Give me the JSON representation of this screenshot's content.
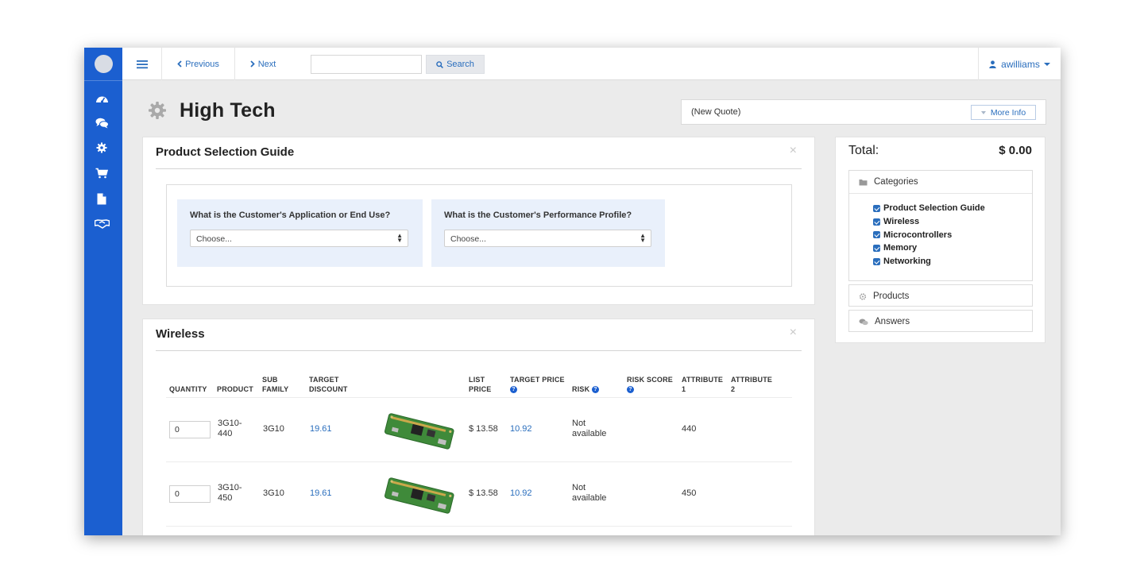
{
  "nav": {
    "previous_label": "Previous",
    "next_label": "Next",
    "search_value": "",
    "search_button_label": "Search",
    "user_name": "awilliams"
  },
  "sidebar": {
    "items": [
      {
        "icon": "dashboard-icon"
      },
      {
        "icon": "comments-icon"
      },
      {
        "icon": "gear-icon"
      },
      {
        "icon": "cart-icon"
      },
      {
        "icon": "document-icon"
      },
      {
        "icon": "handshake-icon"
      }
    ]
  },
  "page": {
    "title": "High Tech",
    "quote_name": "(New Quote)",
    "more_info_label": "More Info"
  },
  "psg": {
    "title": "Product Selection Guide",
    "close": "×",
    "questions": [
      {
        "label": "What is the Customer's Application or End Use?",
        "selected": "Choose..."
      },
      {
        "label": "What is the Customer's Performance Profile?",
        "selected": "Choose..."
      }
    ]
  },
  "wireless": {
    "title": "Wireless",
    "close": "×",
    "columns": {
      "quantity": "QUANTITY",
      "product": "PRODUCT",
      "sub_family_1": "SUB",
      "sub_family_2": "FAMILY",
      "target_discount_1": "TARGET",
      "target_discount_2": "DISCOUNT",
      "list_price_1": "LIST",
      "list_price_2": "PRICE",
      "target_price": "TARGET PRICE",
      "risk": "RISK",
      "risk_score": "RISK SCORE",
      "attr1_1": "ATTRIBUTE",
      "attr1_2": "1",
      "attr2_1": "ATTRIBUTE",
      "attr2_2": "2"
    },
    "rows": [
      {
        "quantity": "0",
        "product_1": "3G10-",
        "product_2": "440",
        "sub_family": "3G10",
        "target_discount": "19.61",
        "list_price": "$ 13.58",
        "target_price": "10.92",
        "risk_1": "Not",
        "risk_2": "available",
        "risk_score": "",
        "attr1": "440",
        "attr2": ""
      },
      {
        "quantity": "0",
        "product_1": "3G10-",
        "product_2": "450",
        "sub_family": "3G10",
        "target_discount": "19.61",
        "list_price": "$ 13.58",
        "target_price": "10.92",
        "risk_1": "Not",
        "risk_2": "available",
        "risk_score": "",
        "attr1": "450",
        "attr2": ""
      }
    ]
  },
  "summary": {
    "total_label": "Total:",
    "total_value": "$ 0.00",
    "categories_label": "Categories",
    "categories": [
      {
        "label": "Product Selection Guide",
        "checked": true
      },
      {
        "label": "Wireless",
        "checked": true
      },
      {
        "label": "Microcontrollers",
        "checked": true
      },
      {
        "label": "Memory",
        "checked": true
      },
      {
        "label": "Networking",
        "checked": true
      }
    ],
    "products_label": "Products",
    "answers_label": "Answers"
  },
  "colors": {
    "sidebar": "#1b5fd0",
    "link": "#2a6ebd",
    "question_bg": "#e9f0fb",
    "page_bg": "#ebebeb"
  }
}
